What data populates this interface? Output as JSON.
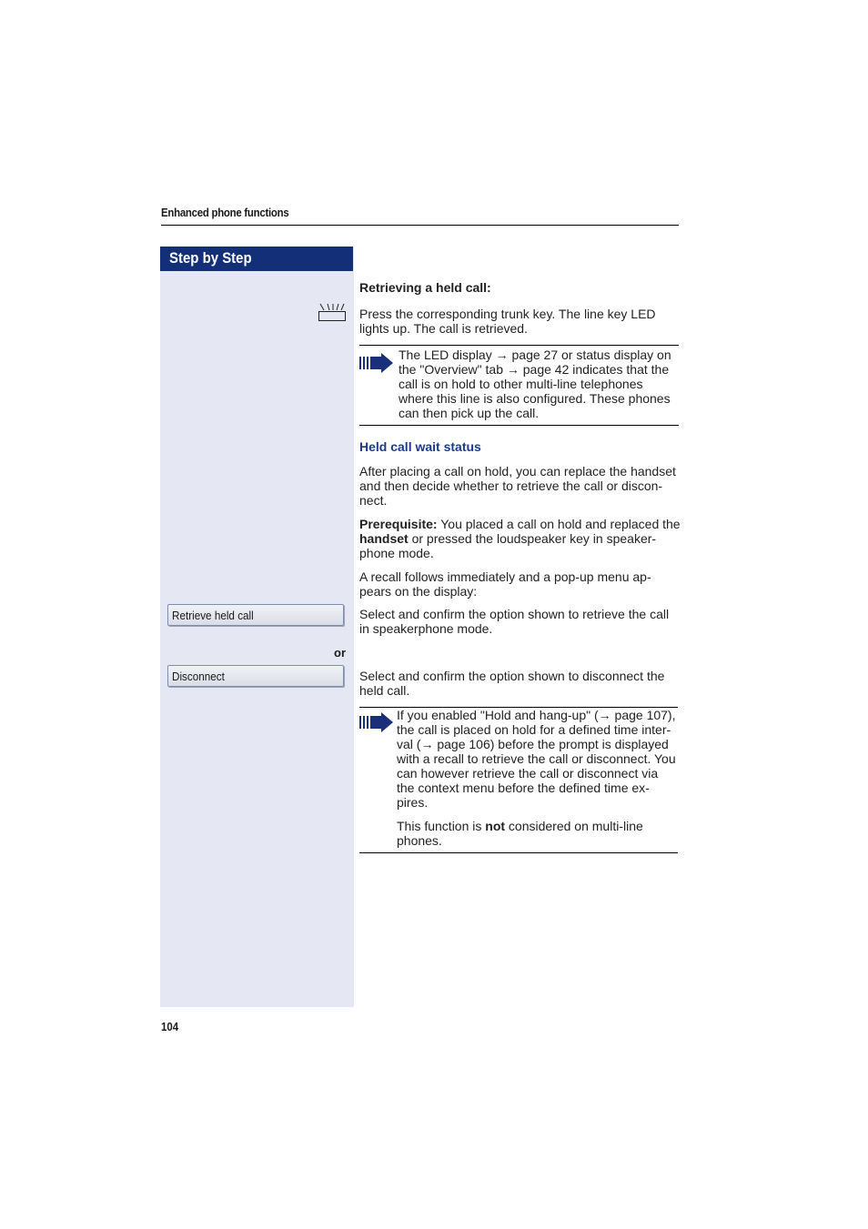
{
  "header": {
    "section_title": "Enhanced phone functions"
  },
  "sidebar": {
    "title": "Step by Step"
  },
  "section1": {
    "heading": "Retrieving a held call:",
    "step_text": "Press the corresponding trunk key. The line key LED lights up. The call is retrieved.",
    "step_icon": "trunk-key-led-icon",
    "note": {
      "icon": "note-arrow-icon",
      "lines": [
        "The LED display → page 27 or status display on",
        "the \"Overview\" tab → page 42 indicates that the",
        "call is on hold to other multi-line telephones",
        "where this line is also configured. These phones",
        "can then pick up the call."
      ]
    }
  },
  "section2": {
    "heading": "Held call wait status",
    "intro_lines": [
      "After placing a call on hold, you can replace the handset",
      "and then decide whether to retrieve the call or discon-",
      "nect."
    ],
    "prereq_label": "Prerequisite:",
    "prereq_line1_rest": " You placed a call on hold and replaced the",
    "prereq_bold2": "handset",
    "prereq_line2_rest": " or pressed the loudspeaker key in speaker-",
    "prereq_line3": "phone mode.",
    "recall_lines": [
      "A recall follows immediately and a pop-up menu ap-",
      "pears on the display:"
    ],
    "options": [
      {
        "label": "Retrieve held call",
        "lines": [
          "Select and confirm the option shown to retrieve the call",
          "in speakerphone mode."
        ]
      },
      {
        "label": "Disconnect",
        "lines": [
          "Select and confirm the option shown to disconnect the",
          "held call."
        ]
      }
    ],
    "or_label": "or",
    "note": {
      "icon": "note-arrow-icon",
      "lines": [
        "If you enabled \"Hold and hang-up\" (→ page 107),",
        "the call is placed on hold for a defined time inter-",
        "val (→ page 106) before the prompt is displayed",
        "with a recall to retrieve the call or disconnect. You",
        "can however retrieve the call or disconnect via",
        "the context menu before the defined time ex-",
        "pires."
      ],
      "extra_pre": "This function is ",
      "extra_bold": "not",
      "extra_post": " considered on multi-line",
      "extra_line2": "phones."
    }
  },
  "footer": {
    "page_number": "104"
  }
}
